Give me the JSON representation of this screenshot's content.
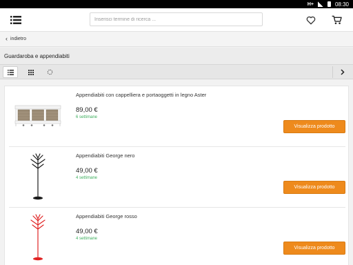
{
  "status_bar": {
    "network": "H+",
    "time": "08:30"
  },
  "header": {
    "menu_icon": "list-menu-icon",
    "search_placeholder": "Inserisci termine di ricerca ...",
    "search_value": "",
    "favorites_icon": "heart-icon",
    "cart_icon": "cart-icon"
  },
  "back": {
    "label": "indietro"
  },
  "category": {
    "title": "Guardaroba e appendiabiti"
  },
  "toolbar": {
    "views": [
      "list-view-icon",
      "grid-view-icon",
      "loading-icon"
    ],
    "active_view": "list",
    "next_icon": "chevron-right-icon"
  },
  "products": [
    {
      "name": "Appendiabiti con cappelliera e portaoggetti in legno Aster",
      "price": "89,00 €",
      "delivery": "6 settimane",
      "button": "Visualizza prodotto",
      "image": "wall-shelf-with-baskets"
    },
    {
      "name": "Appendiabiti George nero",
      "price": "49,00 €",
      "delivery": "4 settimane",
      "button": "Visualizza prodotto",
      "image": "black-coat-stand"
    },
    {
      "name": "Appendiabiti George rosso",
      "price": "49,00 €",
      "delivery": "4 settimane",
      "button": "Visualizza prodotto",
      "image": "red-coat-stand"
    }
  ],
  "colors": {
    "accent": "#ee8a1c",
    "delivery_green": "#3cae5c",
    "black_stand": "#1a1a1a",
    "red_stand": "#e02222"
  }
}
